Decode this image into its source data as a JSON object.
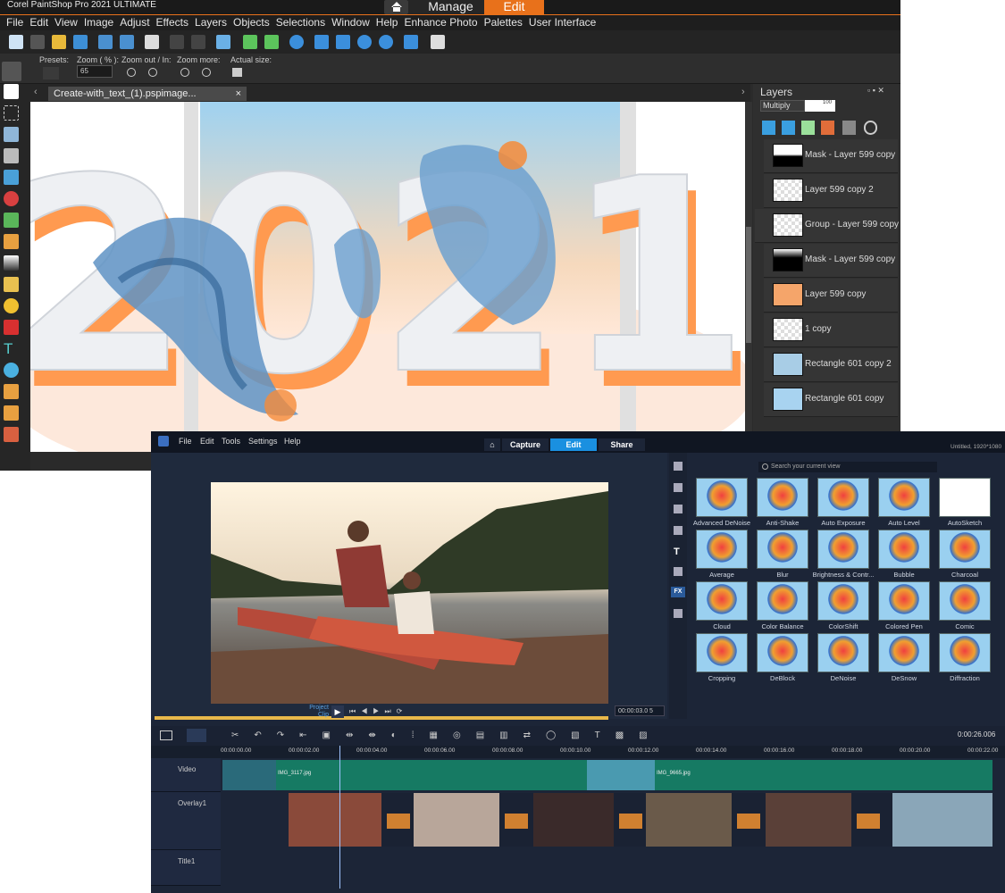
{
  "psp": {
    "title": "Corel PaintShop Pro 2021 ULTIMATE",
    "tabs": {
      "manage": "Manage",
      "edit": "Edit"
    },
    "menu": [
      "File",
      "Edit",
      "View",
      "Image",
      "Adjust",
      "Effects",
      "Layers",
      "Objects",
      "Selections",
      "Window",
      "Help",
      "Enhance Photo",
      "Palettes",
      "User Interface"
    ],
    "options": {
      "presets": "Presets:",
      "zoom_pct": "Zoom ( % ):",
      "zoom_value": "65",
      "zoom_out_in": "Zoom out / In:",
      "zoom_more": "Zoom more:",
      "actual_size": "Actual size:"
    },
    "doc_tab": "Create-with_text_(1).pspimage...",
    "canvas_text": "2021",
    "layers": {
      "title": "Layers",
      "blend": "Multiply",
      "opacity": "100",
      "items": [
        "Mask - Layer 599 copy",
        "Layer 599 copy 2",
        "Group - Layer 599 copy",
        "Mask - Layer 599 copy",
        "Layer 599 copy",
        "1 copy",
        "Rectangle 601 copy 2",
        "Rectangle 601 copy"
      ]
    },
    "colors": {
      "accent": "#e8711b"
    }
  },
  "vs": {
    "menu": [
      "File",
      "Edit",
      "Tools",
      "Settings",
      "Help"
    ],
    "tabs": {
      "capture": "Capture",
      "edit": "Edit",
      "share": "Share"
    },
    "project_info": "Untitled, 1920*1080",
    "search_placeholder": "Search your current view",
    "project_label": "Project",
    "clip_label": "Clip",
    "timecode": "00:00:03.0 5",
    "zoom_time": "0:00:26.006",
    "effects": [
      "Advanced DeNoise",
      "Anti-Shake",
      "Auto Exposure",
      "Auto Level",
      "AutoSketch",
      "Average",
      "Blur",
      "Brightness & Contr...",
      "Bubble",
      "Charcoal",
      "Cloud",
      "Color Balance",
      "ColorShift",
      "Colored Pen",
      "Comic",
      "Cropping",
      "DeBlock",
      "DeNoise",
      "DeSnow",
      "Diffraction"
    ],
    "ruler": [
      "00:00:00.00",
      "00:00:02.00",
      "00:00:04.00",
      "00:00:06.00",
      "00:00:08.00",
      "00:00:10.00",
      "00:00:12.00",
      "00:00:14.00",
      "00:00:16.00",
      "00:00:18.00",
      "00:00:20.00",
      "00:00:22.00"
    ],
    "tracks": {
      "video": "Video",
      "overlay": "Overlay1",
      "title": "Title1"
    },
    "clips": {
      "clip1": "IMG_3117.jpg",
      "clip2": "IMG_9665.jpg"
    }
  }
}
